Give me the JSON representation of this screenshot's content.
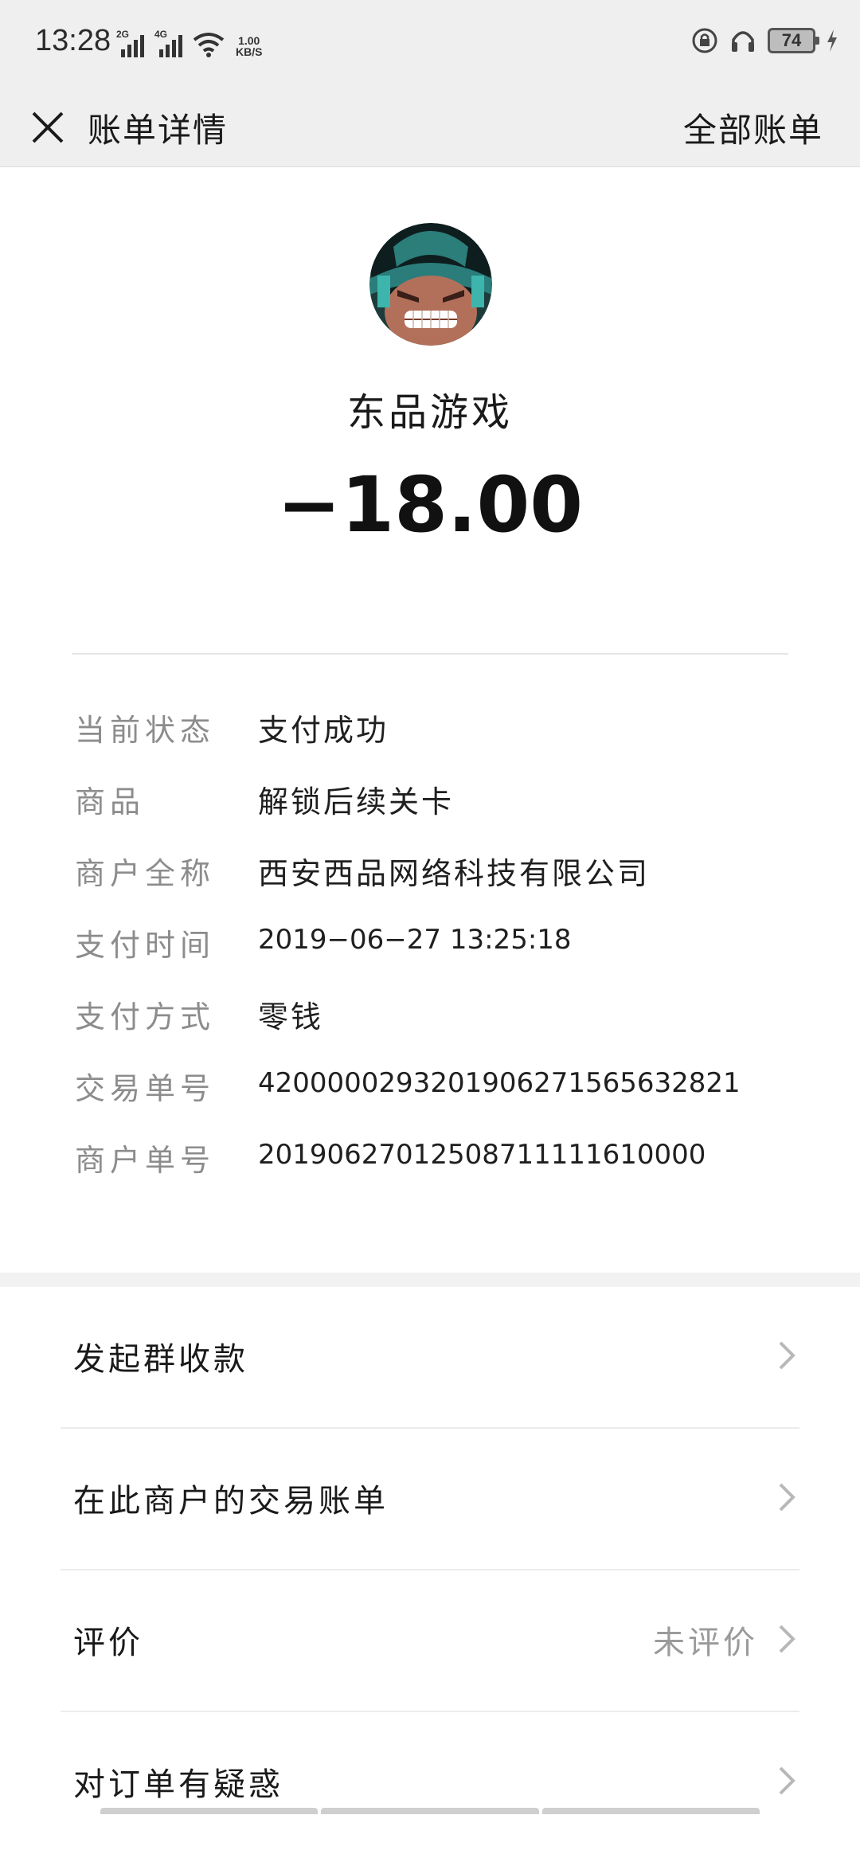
{
  "status_bar": {
    "time": "13:28",
    "signal_1_tag": "2G",
    "signal_2_tag": "4G",
    "net_speed_value": "1.00",
    "net_speed_unit": "KB/S",
    "battery": "74"
  },
  "header": {
    "title": "账单详情",
    "action": "全部账单"
  },
  "merchant": {
    "name": "东品游戏",
    "amount": "−18.00"
  },
  "details": [
    {
      "label": "当前状态",
      "value": "支付成功",
      "numeric": false
    },
    {
      "label": "商品",
      "value": "解锁后续关卡",
      "numeric": false
    },
    {
      "label": "商户全称",
      "value": "西安西品网络科技有限公司",
      "numeric": false
    },
    {
      "label": "支付时间",
      "value": "2019−06−27 13:25:18",
      "numeric": true
    },
    {
      "label": "支付方式",
      "value": "零钱",
      "numeric": false
    },
    {
      "label": "交易单号",
      "value": "4200000293201906271565632821",
      "numeric": true
    },
    {
      "label": "商户单号",
      "value": "20190627012508711111610000",
      "numeric": true
    }
  ],
  "actions": [
    {
      "label": "发起群收款",
      "hint": ""
    },
    {
      "label": "在此商户的交易账单",
      "hint": ""
    },
    {
      "label": "评价",
      "hint": "未评价"
    },
    {
      "label": "对订单有疑惑",
      "hint": ""
    }
  ],
  "colors": {
    "header_bg": "#efefef",
    "label_gray": "#8c8c8c",
    "hint_gray": "#9a9a9a"
  }
}
